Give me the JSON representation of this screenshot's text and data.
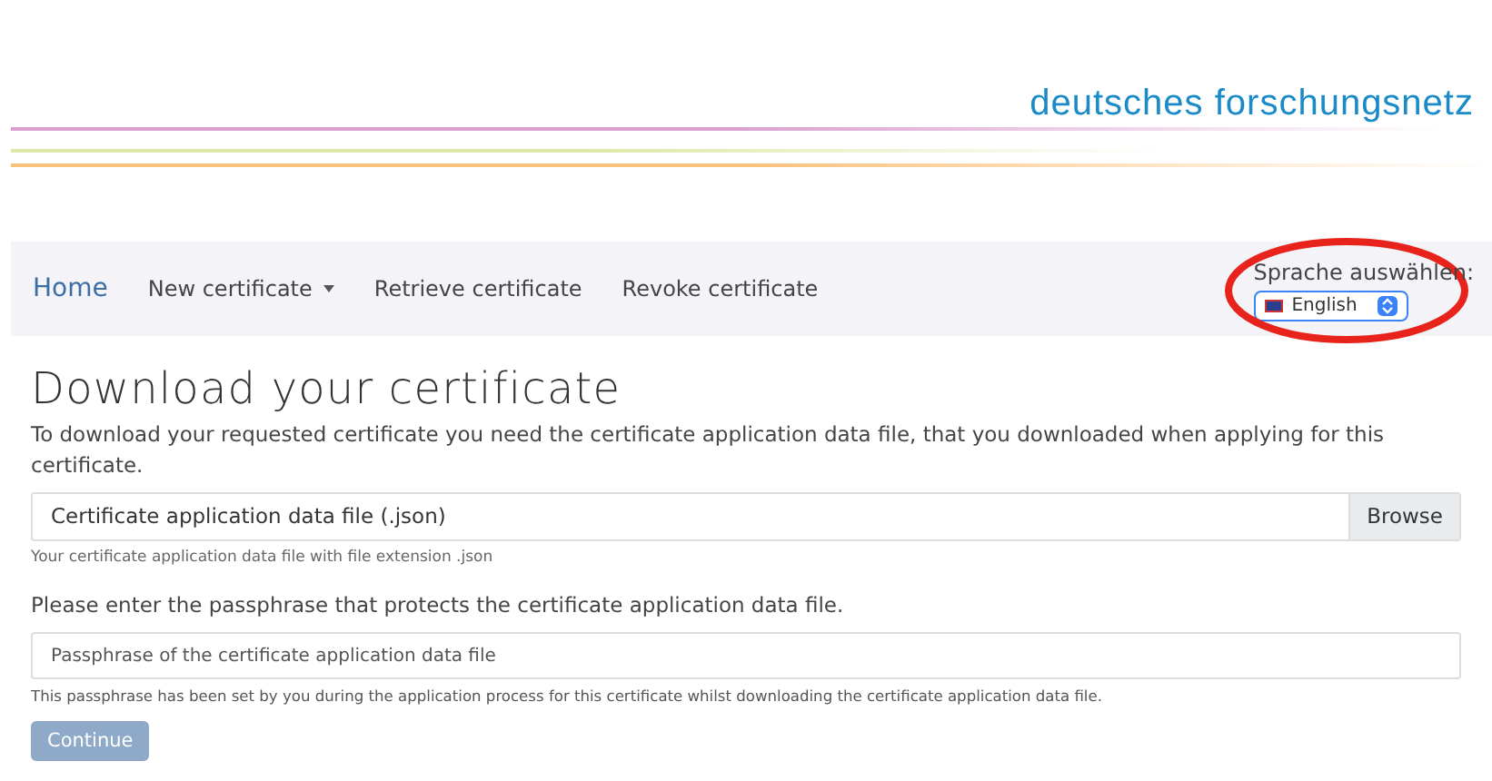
{
  "header": {
    "logo_text": "deutsches forschungsnetz"
  },
  "nav": {
    "items": [
      {
        "label": "Home",
        "selected": true,
        "dropdown": false
      },
      {
        "label": "New certificate",
        "selected": false,
        "dropdown": true
      },
      {
        "label": "Retrieve certificate",
        "selected": false,
        "dropdown": false
      },
      {
        "label": "Revoke certificate",
        "selected": false,
        "dropdown": false
      }
    ],
    "language": {
      "label": "Sprache auswählen:",
      "value": "English",
      "highlighted": true
    }
  },
  "title": "Download your certificate",
  "intro": "To download your requested certificate you need the certificate application data file, that you downloaded when applying for this certificate.",
  "file_field": {
    "placeholder": "Certificate application data file (.json)",
    "button": "Browse",
    "help": "Your certificate application data file with file extension .json"
  },
  "passphrase": {
    "label": "Please enter the passphrase that protects the certificate application data file.",
    "placeholder": "Passphrase of the certificate application data file",
    "help": "This passphrase has been set by you during the application process for this certificate whilst downloading the certificate application data file."
  },
  "continue_button": {
    "label": "Continue",
    "disabled": true
  }
}
